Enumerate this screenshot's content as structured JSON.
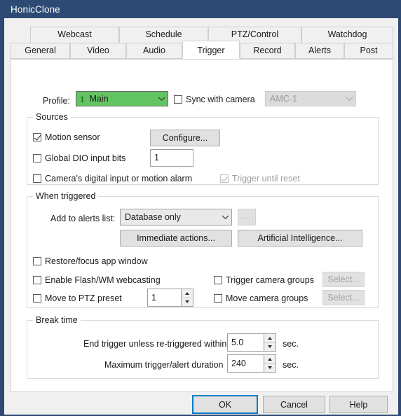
{
  "window": {
    "title": "HonicClone"
  },
  "tabs": {
    "row1": [
      {
        "label": "Webcast",
        "active": false
      },
      {
        "label": "Schedule",
        "active": false
      },
      {
        "label": "PTZ/Control",
        "active": false
      },
      {
        "label": "Watchdog",
        "active": false
      }
    ],
    "row2": [
      {
        "label": "General",
        "active": false
      },
      {
        "label": "Video",
        "active": false
      },
      {
        "label": "Audio",
        "active": false
      },
      {
        "label": "Trigger",
        "active": true
      },
      {
        "label": "Record",
        "active": false
      },
      {
        "label": "Alerts",
        "active": false
      },
      {
        "label": "Post",
        "active": false
      }
    ]
  },
  "profile_row": {
    "label": "Profile:",
    "profile_number": "1",
    "profile_value": "Main",
    "sync_label": "Sync with camera",
    "sync_checked": false,
    "camera_value": "AMC-1",
    "camera_disabled": true
  },
  "sources": {
    "title": "Sources",
    "motion_sensor_label": "Motion sensor",
    "motion_sensor_checked": true,
    "configure_button": "Configure...",
    "global_dio_label": "Global DIO input bits",
    "global_dio_checked": false,
    "global_dio_value": "1",
    "camera_digital_label": "Camera's digital input or motion alarm",
    "camera_digital_checked": false,
    "trigger_until_reset_label": "Trigger until reset",
    "trigger_until_reset_checked": true,
    "trigger_until_reset_disabled": true
  },
  "when_triggered": {
    "title": "When triggered",
    "alerts_list_label": "Add to alerts list:",
    "alerts_list_value": "Database only",
    "ellipsis_button": "...",
    "immediate_actions_button": "Immediate actions...",
    "artificial_intelligence_button": "Artificial Intelligence...",
    "restore_focus_label": "Restore/focus app window",
    "restore_focus_checked": false,
    "enable_flash_label": "Enable Flash/WM webcasting",
    "enable_flash_checked": false,
    "move_ptz_label": "Move to PTZ preset",
    "move_ptz_checked": false,
    "move_ptz_value": "1",
    "trigger_camera_groups_label": "Trigger camera groups",
    "trigger_camera_groups_checked": false,
    "trigger_camera_groups_select": "Select...",
    "move_camera_groups_label": "Move camera groups",
    "move_camera_groups_checked": false,
    "move_camera_groups_select": "Select..."
  },
  "break_time": {
    "title": "Break time",
    "end_trigger_label": "End trigger unless re-triggered within",
    "end_trigger_value": "5.0",
    "end_trigger_unit": "sec.",
    "max_duration_label": "Maximum trigger/alert duration",
    "max_duration_value": "240",
    "max_duration_unit": "sec."
  },
  "footer": {
    "ok_button": "OK",
    "cancel_button": "Cancel",
    "help_button": "Help"
  },
  "colors": {
    "titlebar": "#2c4a73",
    "profile_green": "#62c462",
    "profile_num_green": "#1e7a1e",
    "default_button_focus": "#0a7bc4",
    "page_background": "#ffffff",
    "dialog_background": "#f0f0f0"
  }
}
